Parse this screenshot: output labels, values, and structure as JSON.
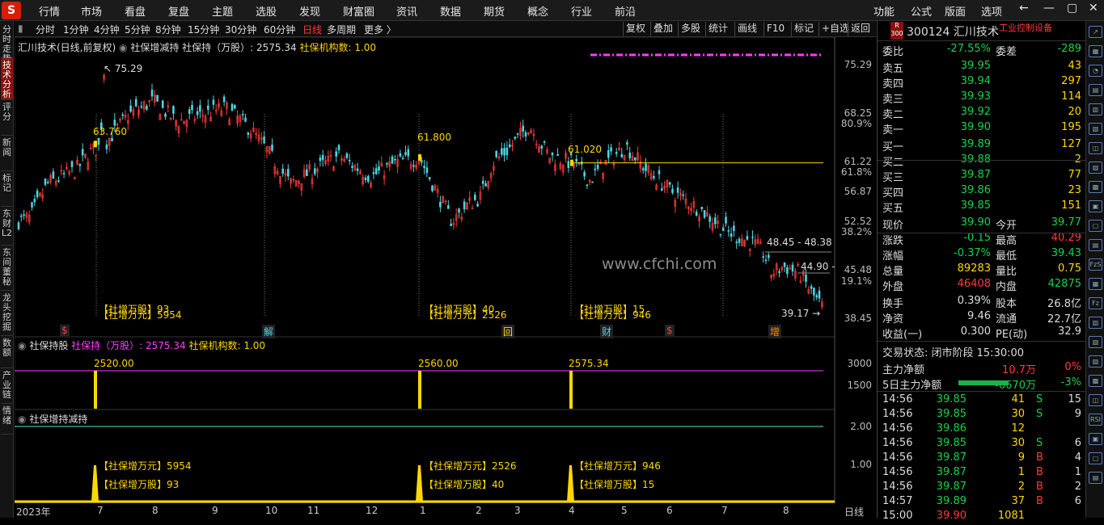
{
  "app": {
    "logo": "S",
    "menu": [
      "行情",
      "市场",
      "看盘",
      "复盘",
      "主题",
      "选股",
      "发现",
      "财富圈",
      "资讯",
      "数据",
      "期货",
      "概念",
      "行业",
      "前沿"
    ],
    "right_menu": [
      "功能",
      "公式",
      "版面",
      "选项"
    ],
    "sys": [
      "←",
      "—",
      "▢",
      "✕"
    ]
  },
  "toolbar": {
    "periods": [
      "分时",
      "1分钟",
      "4分钟",
      "5分钟",
      "8分钟",
      "15分钟",
      "30分钟",
      "60分钟",
      "日线",
      "多周期",
      "更多 〉"
    ],
    "active": "日线",
    "buttons": [
      "复权",
      "叠加",
      "多股",
      "统计",
      "画线",
      "F10",
      "标记",
      "+自选",
      "返回"
    ]
  },
  "left_tabs": [
    "分时走势",
    "技术分析",
    "评分",
    "新闻",
    "标记",
    "东财L2",
    "东间董秘",
    "龙头挖掘",
    "数额",
    "产业链",
    "情绪"
  ],
  "main": {
    "title": "汇川技术(日线,前复权)",
    "indicator_name": "社保增减持",
    "label1": "社保持（万股）: 2575.34",
    "label2": "社保机构数: 1.00",
    "yaxis": [
      "75.29",
      "68.25",
      "80.9%",
      "61.22",
      "61.8%",
      "56.87",
      "52.52",
      "38.2%",
      "45.48",
      "19.1%",
      "38.45"
    ],
    "annotations": {
      "high": "75.29",
      "low": "39.17",
      "p1": "63.760",
      "p2": "61.800",
      "p3": "61.020",
      "r1": "48.45 - 48.38",
      "r2": "44.90 -"
    },
    "events": [
      {
        "l1": "【社增万股】93",
        "l2": "【社增万元】5954"
      },
      {
        "l1": "【社增万股】40",
        "l2": "【社增万元】2526"
      },
      {
        "l1": "【社增万股】15",
        "l2": "【社增万元】946"
      }
    ],
    "markers": [
      "$",
      "解",
      "回",
      "财",
      "$",
      "增"
    ]
  },
  "sub1": {
    "title": "社保持股",
    "label1": "社保持（万股）: 2575.34",
    "label2": "社保机构数: 1.00",
    "yaxis": [
      "3000",
      "1500"
    ],
    "bars": [
      "2520.00",
      "2560.00",
      "2575.34"
    ]
  },
  "sub2": {
    "title": "社保增持减持",
    "yaxis": [
      "2.00",
      "1.00"
    ],
    "events": [
      {
        "a": "【社保增万元】5954",
        "b": "【社保增万股】93"
      },
      {
        "a": "【社保增万元】2526",
        "b": "【社保增万股】40"
      },
      {
        "a": "【社保增万元】946",
        "b": "【社保增万股】15"
      }
    ]
  },
  "xaxis": {
    "labels": [
      "2023年",
      "7",
      "8",
      "9",
      "10",
      "11",
      "12",
      "1",
      "2",
      "3",
      "4",
      "5",
      "6",
      "7",
      "8"
    ],
    "period": "日线"
  },
  "watermark": "www.cfchi.com",
  "quote": {
    "code": "300124",
    "name": "汇川技术",
    "tag": "工业控制设备",
    "badge": "R 300",
    "weibi": [
      "委比",
      "-27.55%",
      "委差",
      "-289"
    ],
    "asks": [
      [
        "卖五",
        "39.95",
        "43"
      ],
      [
        "卖四",
        "39.94",
        "297"
      ],
      [
        "卖三",
        "39.93",
        "114"
      ],
      [
        "卖二",
        "39.92",
        "20"
      ],
      [
        "卖一",
        "39.90",
        "195"
      ]
    ],
    "bids": [
      [
        "买一",
        "39.89",
        "127"
      ],
      [
        "买二",
        "39.88",
        "2"
      ],
      [
        "买三",
        "39.87",
        "77"
      ],
      [
        "买四",
        "39.86",
        "23"
      ],
      [
        "买五",
        "39.85",
        "151"
      ]
    ],
    "stats": [
      [
        "现价",
        "39.90",
        "今开",
        "39.77"
      ],
      [
        "涨跌",
        "-0.15",
        "最高",
        "40.29"
      ],
      [
        "涨幅",
        "-0.37%",
        "最低",
        "39.43"
      ],
      [
        "总量",
        "89283",
        "量比",
        "0.75"
      ],
      [
        "外盘",
        "46408",
        "内盘",
        "42875"
      ]
    ],
    "stats2": [
      [
        "换手",
        "0.39%",
        "股本",
        "26.8亿"
      ],
      [
        "净资",
        "9.46",
        "流通",
        "22.7亿"
      ],
      [
        "收益(一)",
        "0.300",
        "PE(动)",
        "32.9"
      ]
    ],
    "status": "交易状态: 闭市阶段 15:30:00",
    "flow": [
      [
        "主力净额",
        "10.7万",
        "0%"
      ],
      [
        "5日主力净额",
        "-6670万",
        "-3%"
      ]
    ],
    "ticks": [
      [
        "14:56",
        "39.85",
        "41",
        "S",
        "15"
      ],
      [
        "14:56",
        "39.85",
        "30",
        "S",
        "9"
      ],
      [
        "14:56",
        "39.86",
        "12",
        "",
        ""
      ],
      [
        "14:56",
        "39.85",
        "30",
        "S",
        "6"
      ],
      [
        "14:56",
        "39.87",
        "9",
        "B",
        "4"
      ],
      [
        "14:56",
        "39.87",
        "1",
        "B",
        "1"
      ],
      [
        "14:56",
        "39.87",
        "2",
        "B",
        "2"
      ],
      [
        "14:57",
        "39.89",
        "37",
        "B",
        "6"
      ],
      [
        "15:00",
        "39.90",
        "1081",
        "",
        ""
      ]
    ]
  },
  "right_icons": [
    "↗",
    "▦",
    "◔",
    "▤",
    "▥",
    "▧",
    "◫",
    "▨",
    "▩",
    "▣",
    "▢",
    "▤",
    "FzS",
    "▦",
    "Fz",
    "▥",
    "▧",
    "▨",
    "▩",
    "◫",
    "RSI",
    "▣",
    "▢",
    "▤"
  ]
}
